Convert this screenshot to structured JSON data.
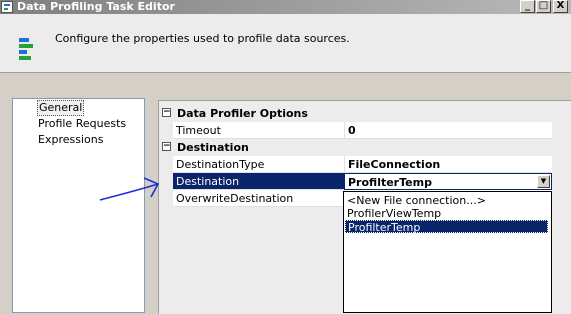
{
  "window": {
    "title": "Data Profiling Task Editor",
    "controls": [
      "_",
      "□",
      "X"
    ]
  },
  "header": {
    "description": "Configure the properties used to profile data sources."
  },
  "nav": {
    "items": [
      {
        "label": "General",
        "selected": true
      },
      {
        "label": "Profile Requests",
        "selected": false
      },
      {
        "label": "Expressions",
        "selected": false
      }
    ]
  },
  "grid": {
    "categories": [
      {
        "label": "Data Profiler Options",
        "toggle": "⊟",
        "props": [
          {
            "name": "Timeout",
            "value": "0"
          }
        ]
      },
      {
        "label": "Destination",
        "toggle": "⊟",
        "props": [
          {
            "name": "DestinationType",
            "value": "FileConnection"
          },
          {
            "name": "Destination",
            "value": "ProfilterTemp"
          },
          {
            "name": "OverwriteDestination",
            "value": ""
          }
        ]
      }
    ]
  },
  "dropdown": {
    "options": [
      {
        "label": "<New File connection...>",
        "selected": false
      },
      {
        "label": "ProfilerViewTemp",
        "selected": false
      },
      {
        "label": "ProfilterTemp",
        "selected": true
      }
    ]
  },
  "colors": {
    "selection": "#0a246a",
    "annotation": "#1a2fd6"
  }
}
